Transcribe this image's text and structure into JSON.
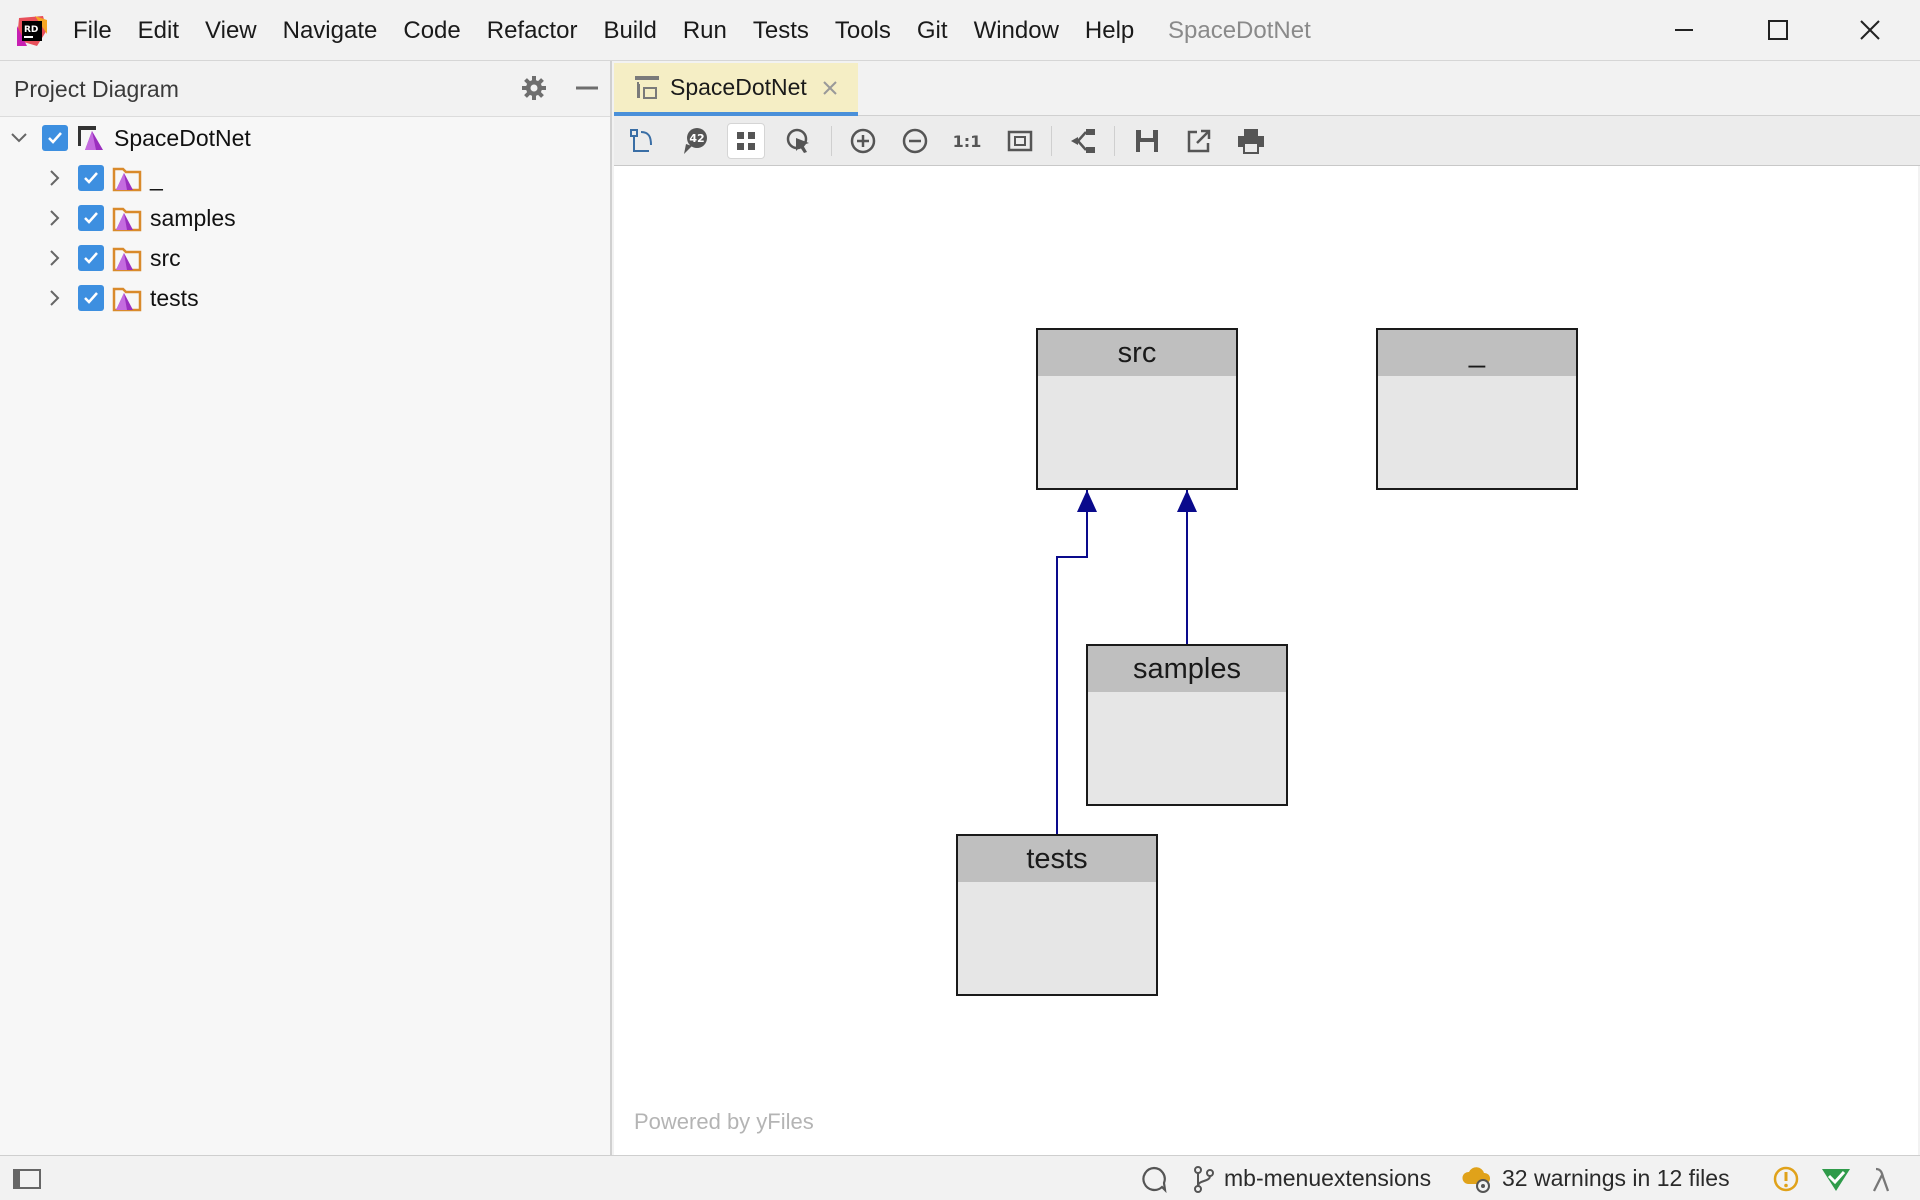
{
  "app": {
    "window_title": "SpaceDotNet",
    "logo_text": "RD"
  },
  "menu": {
    "items": [
      {
        "label": "File"
      },
      {
        "label": "Edit"
      },
      {
        "label": "View"
      },
      {
        "label": "Navigate"
      },
      {
        "label": "Code"
      },
      {
        "label": "Refactor"
      },
      {
        "label": "Build"
      },
      {
        "label": "Run"
      },
      {
        "label": "Tests"
      },
      {
        "label": "Tools"
      },
      {
        "label": "Git"
      },
      {
        "label": "Window"
      },
      {
        "label": "Help"
      }
    ]
  },
  "panel": {
    "title": "Project Diagram",
    "tree": {
      "root": {
        "label": "SpaceDotNet",
        "checked": true,
        "expanded": true
      },
      "children": [
        {
          "label": "_",
          "checked": true
        },
        {
          "label": "samples",
          "checked": true
        },
        {
          "label": "src",
          "checked": true
        },
        {
          "label": "tests",
          "checked": true
        }
      ]
    }
  },
  "editor": {
    "tab_label": "SpaceDotNet",
    "toolbar_badge": "42",
    "toolbar_actual_size": "1:1"
  },
  "diagram": {
    "nodes": [
      {
        "id": "src",
        "label": "src"
      },
      {
        "id": "underscore",
        "label": "_"
      },
      {
        "id": "samples",
        "label": "samples"
      },
      {
        "id": "tests",
        "label": "tests"
      }
    ],
    "edges": [
      {
        "from": "tests",
        "to": "src"
      },
      {
        "from": "samples",
        "to": "src"
      }
    ],
    "watermark": "Powered by yFiles",
    "edge_color": "#0a0a8c"
  },
  "status": {
    "branch": "mb-menuextensions",
    "warnings": "32 warnings in 12 files"
  },
  "colors": {
    "checkbox": "#3d8fe0",
    "tab_active_bg": "#f5eec5",
    "tab_underline": "#4a90d9",
    "node_header": "#bfbfbf",
    "node_body": "#e6e6e6"
  }
}
